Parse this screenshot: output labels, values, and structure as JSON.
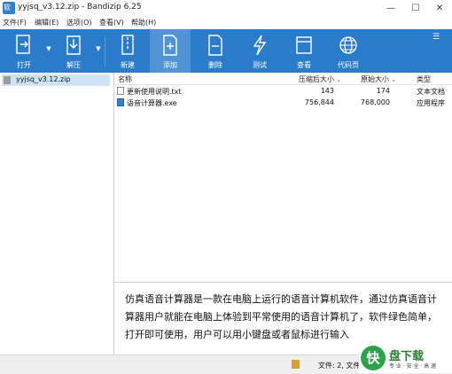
{
  "window": {
    "title": "yyjsq_v3.12.zip - Bandizip 6.25",
    "logo_text": "软",
    "controls": {
      "minimize": "—",
      "maximize": "☐",
      "close": "✕"
    }
  },
  "menu": [
    "文件(F)",
    "编辑(E)",
    "选项(O)",
    "查看(V)",
    "帮助(H)"
  ],
  "toolbar": {
    "open": "打开",
    "extract": "解压",
    "new": "新建",
    "add": "添加",
    "delete": "删除",
    "test": "测试",
    "view": "查看",
    "codepage": "代码页"
  },
  "left_pane": {
    "archive": "yyjsq_v3.12.zip"
  },
  "columns": {
    "name": "名称",
    "packed": "压缩后大小",
    "original": "原始大小",
    "type": "类型"
  },
  "files": [
    {
      "name": "更新使用说明.txt",
      "packed": "143",
      "original": "174",
      "type": "文本文档"
    },
    {
      "name": "语音计算器.exe",
      "packed": "756,844",
      "original": "768,000",
      "type": "应用程序"
    }
  ],
  "description": "仿真语音计算器是一款在电脑上运行的语音计算机软件，通过仿真语音计算器用户就能在电脑上体验到平常使用的语音计算机了，软件绿色简单，打开即可使用，用户可以用小键盘或者鼠标进行输入",
  "status": {
    "text": "文件: 2, 文件夹: 0"
  },
  "watermark": {
    "circle": "快",
    "title": "盘下载",
    "sub": "专 业 · 安 全 · 高 速"
  }
}
